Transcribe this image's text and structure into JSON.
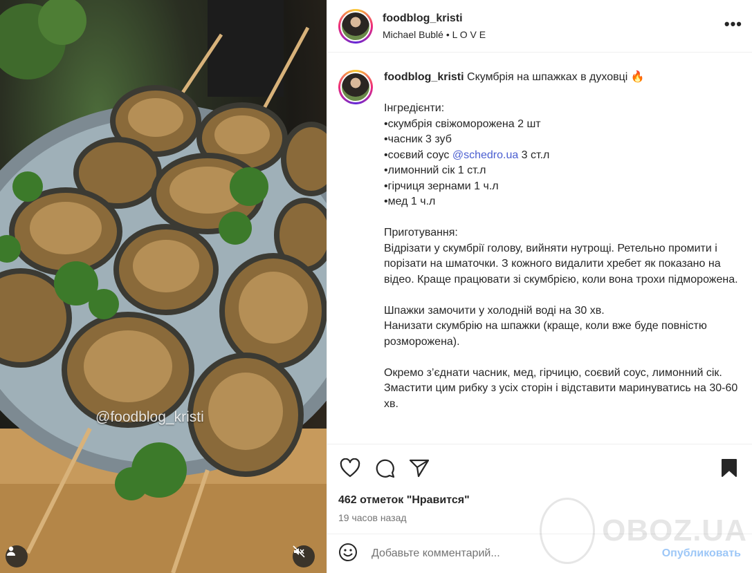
{
  "header": {
    "username": "foodblog_kristi",
    "music": "Michael Bublé • L O V E",
    "more_icon": "more-horizontal-icon"
  },
  "media": {
    "watermark": "@foodblog_kristi"
  },
  "caption": {
    "username": "foodblog_kristi",
    "title": "Скумбрія на шпажках в духовці",
    "title_emoji": "🔥",
    "ingredients_heading": "Інгредієнти:",
    "ingredients": [
      "•скумбрія свіжоморожена 2 шт",
      "•часник 3 зуб",
      "•соєвий соус ",
      "•лимонний сік 1 ст.л",
      "•гірчиця зернами 1 ч.л",
      "•мед 1 ч.л"
    ],
    "soy_mention": "@schedro.ua",
    "soy_amount": " 3 ст.л",
    "prep_heading": "Приготування:",
    "prep_1": "Відрізати у скумбрії голову, вийняти нутрощі. Ретельно промити і порізати на шматочки. З кожного видалити хребет як показано на відео. Краще працювати зі скумбрією, коли вона трохи підморожена.",
    "prep_2a": "Шпажки замочити у холодній воді на 30 хв.",
    "prep_2b": "Нанизати скумбрію на шпажки (краще, коли вже буде повністю розморожена).",
    "prep_3a": "Окремо з’єднати часник, мед, гірчицю, соєвий соус, лимонний сік.",
    "prep_3b": "Змастити цим рибку з усіх сторін і відставити маринуватись на 30-60 хв."
  },
  "actions": {
    "likes": "462 отметок \"Нравится\"",
    "time": "19 часов назад"
  },
  "comment": {
    "placeholder": "Добавьте комментарий...",
    "post_label": "Опубликовать"
  },
  "overlay_watermark": "OBOZ.UA"
}
